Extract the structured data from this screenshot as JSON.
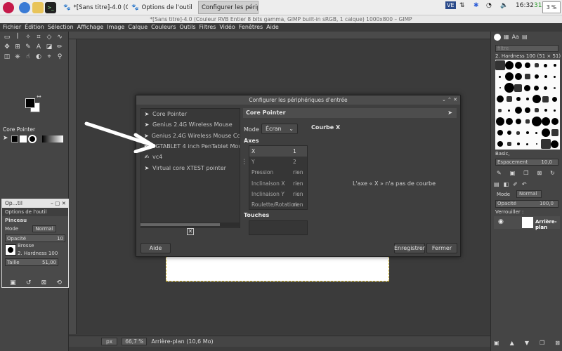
{
  "taskbar": {
    "tasks": [
      {
        "label": "*[Sans titre]-4.0 (Coul..."
      },
      {
        "label": "Options de l'outil"
      },
      {
        "label": "Configurer les périph..."
      }
    ],
    "tray": {
      "lang": "VE",
      "clock": "16:32",
      "temp": "31",
      "battery": "3 %"
    }
  },
  "gimp": {
    "title": "*[Sans titre]-4.0 (Couleur RVB Entier 8 bits gamma, GIMP built-in sRGB, 1 calque) 1000x800 – GIMP",
    "menu": [
      "Fichier",
      "Édition",
      "Sélection",
      "Affichage",
      "Image",
      "Calque",
      "Couleurs",
      "Outils",
      "Filtres",
      "Vidéo",
      "Fenêtres",
      "Aide"
    ],
    "tool_panel_label": "Core Pointer"
  },
  "tool_options": {
    "title": "Op...til",
    "tab": "Options de l'outil",
    "section": "Pinceau",
    "mode_label": "Mode",
    "mode_value": "Normal",
    "opacity_label": "Opacité",
    "opacity_value": "10",
    "brush_label": "Brosse",
    "brush_value": "2. Hardness 100",
    "size_label": "Taille",
    "size_value": "51,00"
  },
  "status": {
    "unit": "px",
    "zoom": "66,7 %",
    "layer": "Arrière-plan (10,6 Mo)"
  },
  "dock": {
    "filter_placeholder": "filtre",
    "brush_name": "2. Hardness 100 (51 × 51)",
    "preset": "Basic,",
    "spacing_label": "Espacement",
    "spacing_value": "10,0",
    "mode_label": "Mode",
    "mode_value": "Normal",
    "opacity_label": "Opacité",
    "opacity_value": "100,0",
    "lock_label": "Verrouiller :",
    "layer_name": "Arrière-plan"
  },
  "dialog": {
    "title": "Configurer les périphériques d'entrée",
    "devices": [
      {
        "label": "Core Pointer",
        "icon": "pointer-icon"
      },
      {
        "label": "Genius 2.4G Wireless Mouse",
        "icon": "pointer-icon"
      },
      {
        "label": "Genius 2.4G Wireless Mouse Consume",
        "icon": "pointer-icon"
      },
      {
        "label": "UGTABLET 4 inch PenTablet Mouse",
        "icon": "pen-icon"
      },
      {
        "label": "vc4",
        "icon": "tablet-icon"
      },
      {
        "label": "Virtual core XTEST pointer",
        "icon": "pointer-icon"
      }
    ],
    "selected_device": "Core Pointer",
    "mode_label": "Mode",
    "mode_value": "Écran",
    "axes_label": "Axes",
    "axes": [
      {
        "name": "X",
        "value": "1"
      },
      {
        "name": "Y",
        "value": "2"
      },
      {
        "name": "Pression",
        "value": "rien"
      },
      {
        "name": "Inclinaison X",
        "value": "rien"
      },
      {
        "name": "Inclinaison Y",
        "value": "rien"
      },
      {
        "name": "Roulette/Rotation",
        "value": "rien"
      }
    ],
    "curve_label": "Courbe X",
    "curve_message": "L'axe « X » n'a pas de courbe",
    "touches_label": "Touches",
    "help_button": "Aide",
    "save_button": "Enregistrer",
    "close_button": "Fermer"
  }
}
